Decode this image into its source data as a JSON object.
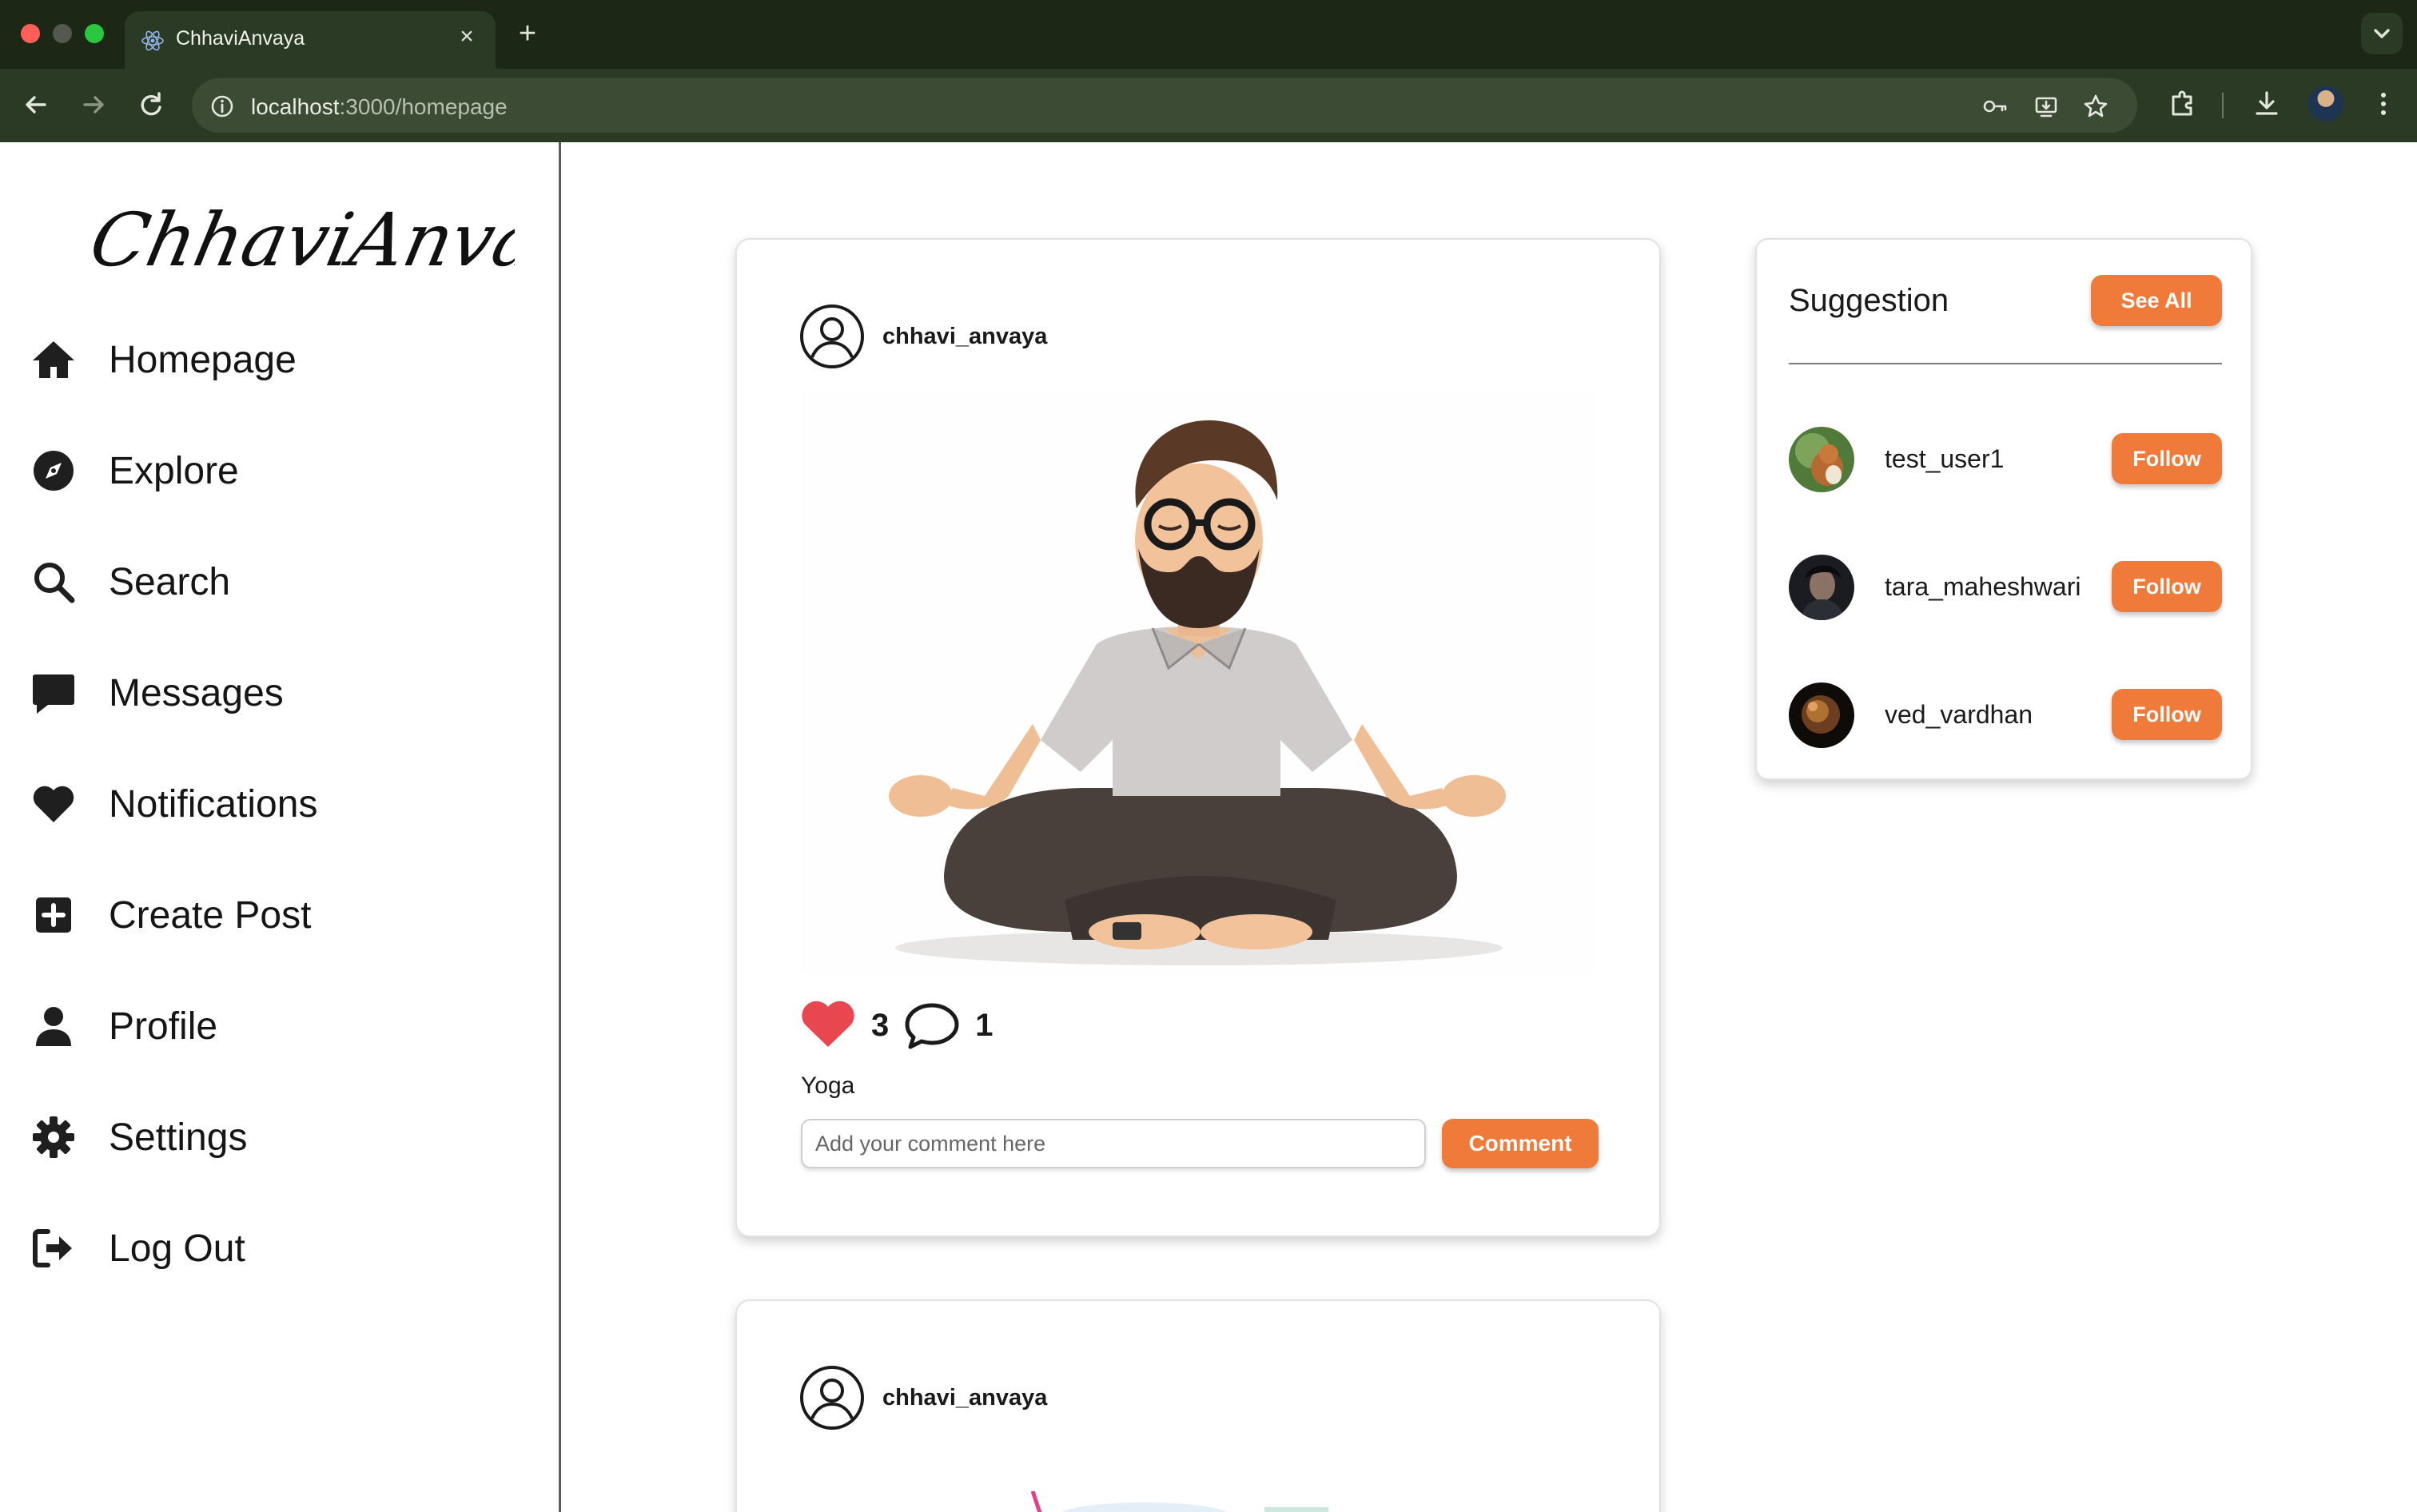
{
  "browser": {
    "tab_title": "ChhaviAnvaya",
    "new_tab": "+",
    "close_tab": "×",
    "url_host": "localhost",
    "url_rest": ":3000/homepage"
  },
  "sidebar": {
    "logo_text": "ChhaviAnvaya",
    "items": [
      {
        "label": "Homepage",
        "icon": "home-icon"
      },
      {
        "label": "Explore",
        "icon": "compass-icon"
      },
      {
        "label": "Search",
        "icon": "search-icon"
      },
      {
        "label": "Messages",
        "icon": "message-icon"
      },
      {
        "label": "Notifications",
        "icon": "heart-icon"
      },
      {
        "label": "Create Post",
        "icon": "plus-square-icon"
      },
      {
        "label": "Profile",
        "icon": "user-icon"
      },
      {
        "label": "Settings",
        "icon": "gear-icon"
      },
      {
        "label": "Log Out",
        "icon": "logout-icon"
      }
    ]
  },
  "posts": [
    {
      "username": "chhavi_anvaya",
      "likes": "3",
      "comments": "1",
      "caption": "Yoga",
      "comment_placeholder": "Add your comment here",
      "comment_button": "Comment"
    },
    {
      "username": "chhavi_anvaya"
    }
  ],
  "suggestions": {
    "title": "Suggestion",
    "see_all": "See All",
    "users": [
      {
        "username": "test_user1",
        "button": "Follow"
      },
      {
        "username": "tara_maheshwari",
        "button": "Follow"
      },
      {
        "username": "ved_vardhan",
        "button": "Follow"
      }
    ]
  },
  "colors": {
    "accent": "#f07a3a",
    "like": "#e8474f",
    "chrome_bg": "#2b3a24"
  }
}
